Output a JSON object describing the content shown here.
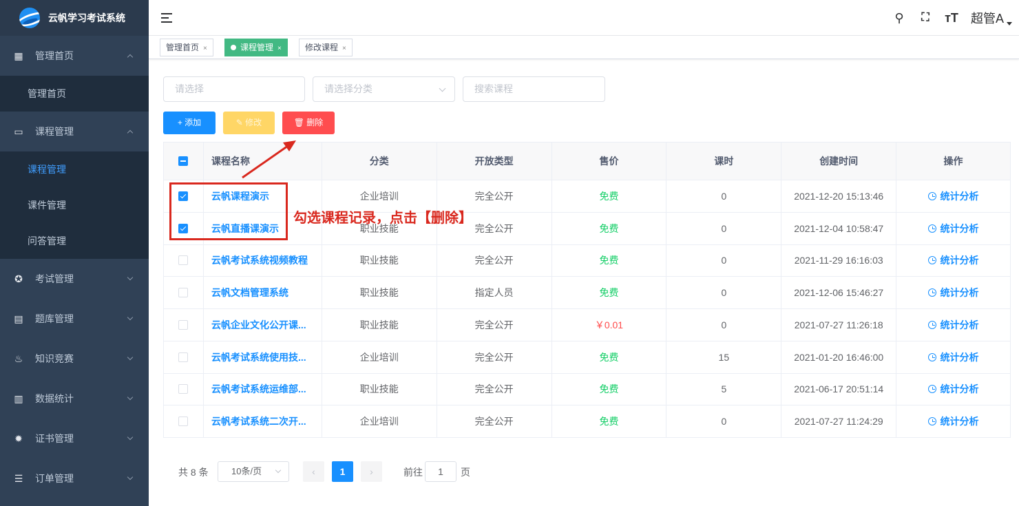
{
  "app": {
    "title": "云帆学习考试系统"
  },
  "sidebar": {
    "groups": [
      {
        "label": "管理首页",
        "icon": "dashboard-icon",
        "items": [
          "管理首页"
        ]
      },
      {
        "label": "课程管理",
        "icon": "book-icon",
        "items": [
          "课程管理",
          "课件管理",
          "问答管理"
        ]
      },
      {
        "label": "考试管理",
        "icon": "exam-icon",
        "items": []
      },
      {
        "label": "题库管理",
        "icon": "document-icon",
        "items": []
      },
      {
        "label": "知识竞赛",
        "icon": "fire-icon",
        "items": []
      },
      {
        "label": "数据统计",
        "icon": "bar-chart-icon",
        "items": []
      },
      {
        "label": "证书管理",
        "icon": "certificate-icon",
        "items": []
      },
      {
        "label": "订单管理",
        "icon": "list-icon",
        "items": []
      }
    ]
  },
  "header": {
    "user": "超管A"
  },
  "tags": [
    "管理首页",
    "课程管理",
    "修改课程"
  ],
  "filters": {
    "select_placeholder": "请选择",
    "category_placeholder": "请选择分类",
    "search_placeholder": "搜索课程"
  },
  "toolbar": {
    "add": "+ 添加",
    "edit": "✎ 修改",
    "delete": "🗑 删除"
  },
  "table": {
    "columns": [
      "课程名称",
      "分类",
      "开放类型",
      "售价",
      "课时",
      "创建时间",
      "操作"
    ],
    "rows": [
      {
        "checked": true,
        "name": "云帆课程演示",
        "category": "企业培训",
        "open": "完全公开",
        "price": "免费",
        "hours": "0",
        "created": "2021-12-20 15:13:46",
        "action": "统计分析"
      },
      {
        "checked": true,
        "name": "云帆直播课演示",
        "category": "职业技能",
        "open": "完全公开",
        "price": "免费",
        "hours": "0",
        "created": "2021-12-04 10:58:47",
        "action": "统计分析"
      },
      {
        "checked": false,
        "name": "云帆考试系统视频教程",
        "category": "职业技能",
        "open": "完全公开",
        "price": "免费",
        "hours": "0",
        "created": "2021-11-29 16:16:03",
        "action": "统计分析"
      },
      {
        "checked": false,
        "name": "云帆文档管理系统",
        "category": "职业技能",
        "open": "指定人员",
        "price": "免费",
        "hours": "0",
        "created": "2021-12-06 15:46:27",
        "action": "统计分析"
      },
      {
        "checked": false,
        "name": "云帆企业文化公开课...",
        "category": "职业技能",
        "open": "完全公开",
        "price": "￥0.01",
        "hours": "0",
        "created": "2021-07-27 11:26:18",
        "action": "统计分析"
      },
      {
        "checked": false,
        "name": "云帆考试系统使用技...",
        "category": "企业培训",
        "open": "完全公开",
        "price": "免费",
        "hours": "15",
        "created": "2021-01-20 16:46:00",
        "action": "统计分析"
      },
      {
        "checked": false,
        "name": "云帆考试系统运维部...",
        "category": "职业技能",
        "open": "完全公开",
        "price": "免费",
        "hours": "5",
        "created": "2021-06-17 20:51:14",
        "action": "统计分析"
      },
      {
        "checked": false,
        "name": "云帆考试系统二次开...",
        "category": "企业培训",
        "open": "完全公开",
        "price": "免费",
        "hours": "0",
        "created": "2021-07-27 11:24:29",
        "action": "统计分析"
      }
    ]
  },
  "annotation": {
    "text": "勾选课程记录，点击【删除】",
    "color": "#d9281e"
  },
  "pagination": {
    "total": "共 8 条",
    "page_size": "10条/页",
    "current": "1",
    "goto_label": "前往",
    "goto_value": "1",
    "page_suffix": "页"
  },
  "colors": {
    "sidebar": "#304156",
    "primary": "#1890ff",
    "success": "#42b983",
    "warning": "#ffd666",
    "danger": "#ff4d4f",
    "free": "#13ce66"
  }
}
